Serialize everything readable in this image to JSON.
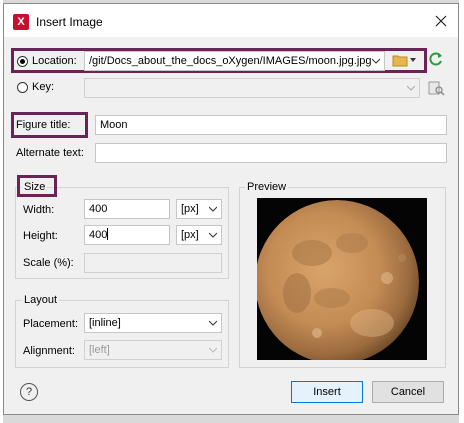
{
  "window": {
    "title": "Insert Image",
    "app_icon": "oxygen-x-icon"
  },
  "location": {
    "label": "Location:",
    "value": "/git/Docs_about_the_docs_oXygen/IMAGES/moon.jpg.jpg",
    "selected": true
  },
  "key": {
    "label": "Key:",
    "value": "",
    "selected": false
  },
  "figure_title": {
    "label": "Figure title:",
    "value": "Moon"
  },
  "alternate_text": {
    "label": "Alternate text:",
    "value": ""
  },
  "size": {
    "title": "Size",
    "width": {
      "label": "Width:",
      "value": "400",
      "unit": "[px]"
    },
    "height": {
      "label": "Height:",
      "value": "400",
      "unit": "[px]"
    },
    "scale": {
      "label": "Scale (%):",
      "value": ""
    }
  },
  "layout": {
    "title": "Layout",
    "placement": {
      "label": "Placement:",
      "value": "[inline]"
    },
    "alignment": {
      "label": "Alignment:",
      "value": "[left]"
    }
  },
  "preview": {
    "title": "Preview"
  },
  "buttons": {
    "insert": "Insert",
    "cancel": "Cancel",
    "help": "?"
  },
  "colors": {
    "highlight": "#6b2356",
    "accent": "#0078d7",
    "refresh": "#2e9a3e",
    "folder": "#e6b84a"
  }
}
